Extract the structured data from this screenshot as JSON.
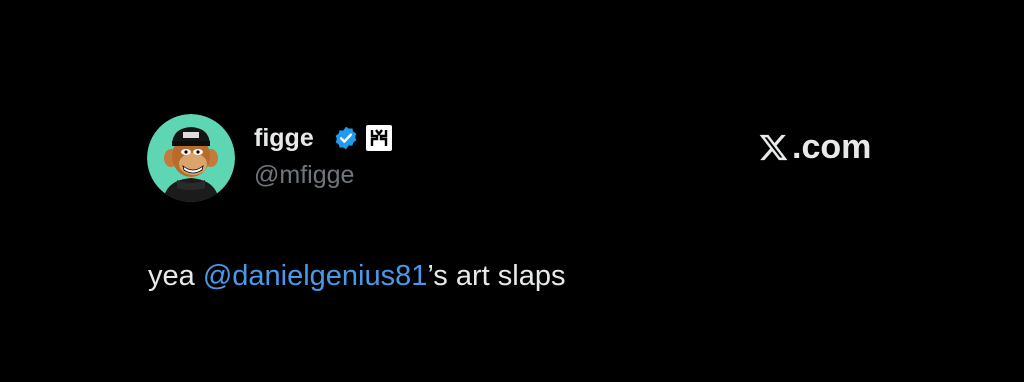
{
  "author": {
    "display_name": "figge",
    "handle": "@mfigge",
    "avatar_icon": "bored-ape-avatar-icon",
    "verified_icon": "verified-badge-icon",
    "affiliate_icon": "affiliate-logo-icon"
  },
  "brand": {
    "label": ".com",
    "icon": "x-logo-icon"
  },
  "tweet": {
    "prefix": "yea ",
    "mention": "@danielgenius81",
    "suffix": "’s art slaps"
  },
  "colors": {
    "background": "#000000",
    "text_primary": "#e7e9ea",
    "text_secondary": "#71767b",
    "link": "#4a99e9",
    "verified": "#1d9bf0",
    "avatar_bg": "#5fd6b3"
  }
}
